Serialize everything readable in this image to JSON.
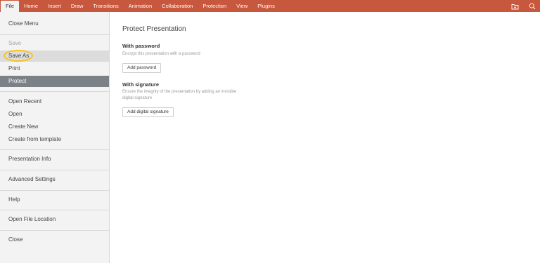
{
  "menubar": {
    "tabs": [
      {
        "label": "File",
        "active": true
      },
      {
        "label": "Home"
      },
      {
        "label": "Insert"
      },
      {
        "label": "Draw"
      },
      {
        "label": "Transitions"
      },
      {
        "label": "Animation"
      },
      {
        "label": "Collaboration"
      },
      {
        "label": "Protection"
      },
      {
        "label": "View"
      },
      {
        "label": "Plugins"
      }
    ],
    "right_icons": [
      "open-file-location-icon",
      "search-icon"
    ],
    "accent_color": "#c7573d"
  },
  "sidebar": {
    "close_menu": "Close Menu",
    "save": "Save",
    "save_as": "Save As",
    "print": "Print",
    "protect": "Protect",
    "open_recent": "Open Recent",
    "open": "Open",
    "create_new": "Create New",
    "create_from_template": "Create from template",
    "presentation_info": "Presentation Info",
    "advanced_settings": "Advanced Settings",
    "help": "Help",
    "open_file_location": "Open File Location",
    "close": "Close",
    "selected_item": "Protect",
    "highlight_color": "#f5c324"
  },
  "main": {
    "title": "Protect Presentation",
    "password": {
      "heading": "With password",
      "description": "Encrypt this presentation with a password",
      "button": "Add password"
    },
    "signature": {
      "heading": "With signature",
      "description": "Ensure the integrity of the presentation by adding an invisible digital signature",
      "button": "Add digital signature"
    }
  }
}
